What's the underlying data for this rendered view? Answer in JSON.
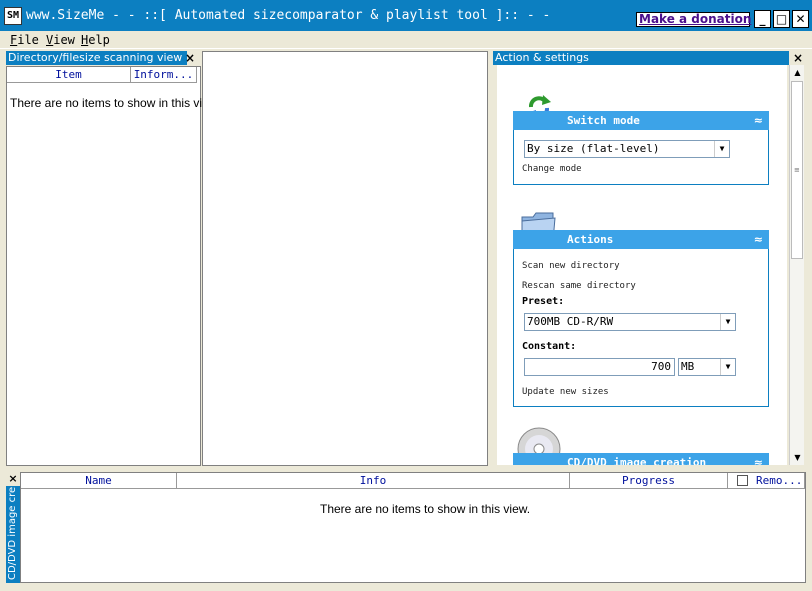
{
  "window": {
    "icon_text": "SM",
    "title": "www.SizeMe - - ::[ Automated sizecomparator & playlist tool ]:: - -",
    "donate_link": "Make a donation",
    "min_glyph": "_",
    "max_glyph": "□",
    "close_glyph": "✕"
  },
  "menu": [
    {
      "key": "F",
      "rest": "ile"
    },
    {
      "key": "V",
      "rest": "iew"
    },
    {
      "key": "H",
      "rest": "elp"
    }
  ],
  "left_panel": {
    "title": "Directory/filesize scanning view",
    "close_glyph": "×",
    "columns": [
      "Item",
      "Inform..."
    ],
    "empty_message": "There are no items to show in this view."
  },
  "right_panel": {
    "title": "Action & settings",
    "close_glyph": "×",
    "groups": {
      "switch_mode": {
        "title": "Switch mode",
        "icon": "refresh-arrows-icon",
        "mode_select": "By size (flat-level)",
        "change_mode_link": "Change mode"
      },
      "actions": {
        "title": "Actions",
        "icon": "folder-icon",
        "scan_link": "Scan new directory",
        "rescan_link": "Rescan same directory",
        "preset_label": "Preset:",
        "preset_value": "700MB CD-R/RW",
        "constant_label": "Constant:",
        "constant_value": "700",
        "unit_value": "MB",
        "update_link": "Update new sizes"
      },
      "cd_dvd": {
        "title": "CD/DVD image creation",
        "icon": "cd-disc-icon"
      }
    },
    "collapse_glyph": "≈",
    "scroll_up_glyph": "▲",
    "scroll_down_glyph": "▼",
    "thumb_grip": "≡"
  },
  "bottom_panel": {
    "side_label": "CD/DVD image cre...",
    "close_glyph": "×",
    "columns": [
      "Name",
      "Info",
      "Progress",
      "Remo..."
    ],
    "empty_message": "There are no items to show in this view."
  }
}
